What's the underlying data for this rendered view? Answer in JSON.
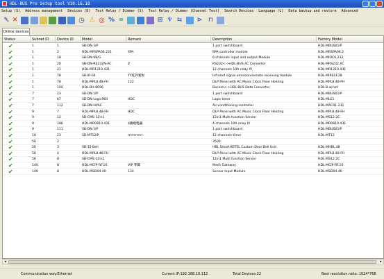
{
  "window": {
    "title": "HDL-BUS Pro Setup tool V10.16.18"
  },
  "menu": [
    "Setup (S)",
    "Address management",
    "Devices (D)",
    "Test Relay / Dimmer (S)",
    "Test Relay / Dimmer (Channel Test)",
    "Search Devices",
    "Language (L)",
    "Data backup and restore",
    "Advanced"
  ],
  "toolbar": {
    "icons": [
      "delete-icon",
      "close-icon",
      "grid-icon",
      "refresh-icon",
      "settings-icon",
      "table-icon",
      "save-icon",
      "monitor-icon",
      "clock-icon",
      "alert-icon",
      "upload-icon",
      "tools-icon",
      "export-icon",
      "list-icon",
      "chart-icon",
      "sync-icon",
      "tree-icon",
      "copy-icon",
      "network-icon",
      "search-icon",
      "filter-icon",
      "print-icon",
      "window-icon"
    ]
  },
  "tab": {
    "label": "Online devices"
  },
  "table": {
    "columns": [
      "Status",
      "Subnet ID",
      "Device ID",
      "Model",
      "Remark",
      "Description",
      "Factory Model"
    ],
    "rows": [
      [
        "✔",
        "1",
        "1",
        "SB-DN-1IP",
        "",
        "1 port switchboard",
        "HDL-MBUS01IP"
      ],
      [
        "✔",
        "1",
        "2",
        "HDL-MRSPA06.231",
        "SPA",
        "SPA controller module",
        "HDL-MRSPA06.2"
      ],
      [
        "✔",
        "1",
        "18",
        "SB-DN-6B/G",
        "",
        "6 channels input and output Module",
        "HDL-MIOC6.232"
      ],
      [
        "✔",
        "1",
        "20",
        "SB-DN-RS232N-AC",
        "Z",
        "RS232<->HDL-BUS AC Converter",
        "HDL-MRS232.AC"
      ],
      [
        "✔",
        "1",
        "21",
        "HDL-MR1210.431",
        "",
        "12 channels 10A relay IV",
        "HDL-MR1210.431"
      ],
      [
        "✔",
        "1",
        "78",
        "SB-IR-04",
        "YY红外发射",
        "Infrared signal emission/remote receiving module",
        "HDL-MIR01F.28"
      ],
      [
        "✔",
        "1",
        "78",
        "HDL-MPL8.48-FH",
        "122",
        "DLP Panel with AC Music Clock Floor Heating",
        "HDL-MPL8.48-FH"
      ],
      [
        "✔",
        "1",
        "100",
        "HDL-BH-8096",
        "",
        "Bacnet<->HDL-BUS Data Converter",
        "HDL-B.acnet"
      ],
      [
        "✔",
        "7",
        "23",
        "SB-DN-1IP",
        "",
        "1 port switchboard",
        "HDL-MBUS01IP"
      ],
      [
        "✔",
        "7",
        "67",
        "SB-DN-Logic960",
        "HDC",
        "Logic timer",
        "HDL-MLE1"
      ],
      [
        "✔",
        "7",
        "112",
        "SB-DN-HVAC",
        "",
        "Air-conditioning controller",
        "HDL-MAC01.231"
      ],
      [
        "✔",
        "9",
        "7",
        "HDL-MPL8.48-FH",
        "HDC",
        "DLP Panel with AC Music Clock Floor Heating",
        "HDL-MPL8.48-FH"
      ],
      [
        "✔",
        "9",
        "12",
        "SB-CMS-12in1",
        "",
        "12in1 Multi function Sensor",
        "HDL-MS12.2C"
      ],
      [
        "✔",
        "9",
        "186",
        "HDL-MR0810.431",
        "4路继电器",
        "4 channels 10A relay IV",
        "HDL-MR0810.431"
      ],
      [
        "✔",
        "9",
        "111",
        "SB-DN-1IP",
        "",
        "1 port switchboard",
        "HDL-MBUS01IP"
      ],
      [
        "✔",
        "10",
        "23",
        "SB-MT12IP",
        "rrrrrrrrrrrr",
        "12 channels timer",
        "HDL-MT12"
      ],
      [
        "✔",
        "50",
        "2",
        "",
        "",
        "3500",
        ""
      ],
      [
        "✔",
        "50",
        "3",
        "SB-15-Bell",
        "",
        "HBL SmartHOTEL Custom Door Bell Unit",
        "HDL-MHBL.48"
      ],
      [
        "✔",
        "50",
        "4",
        "HDL-MPL8.48-FH",
        "",
        "DLP Panel with AC Music Clock Floor Heating",
        "HDL-MPL8.48-FH"
      ],
      [
        "✔",
        "50",
        "8",
        "SB-CMS-12in1",
        "",
        "12in1 Multi function Sensor",
        "HDL-MS12.2C"
      ],
      [
        "✔",
        "140",
        "8",
        "HDL-MCIP-RF.10",
        "VIP 专属",
        "Mesh Gateway",
        "HDL-MCIP-RF.10"
      ],
      [
        "✔",
        "140",
        "8",
        "HDL-MSD04.40",
        "134",
        "Sensor Input Module",
        "HDL-MSD04.40"
      ]
    ]
  },
  "statusbar": {
    "comm_way": "Communication way:Ethernet",
    "ip": "Current IP:192.168.10.112",
    "total": "Total Devices:22",
    "resolution": "Best resolution ratio: 1024*768"
  },
  "colors": {
    "title_bar": "#1f4fb8",
    "status_ok": "#1a9a1a",
    "window_bg": "#ece9d8"
  }
}
